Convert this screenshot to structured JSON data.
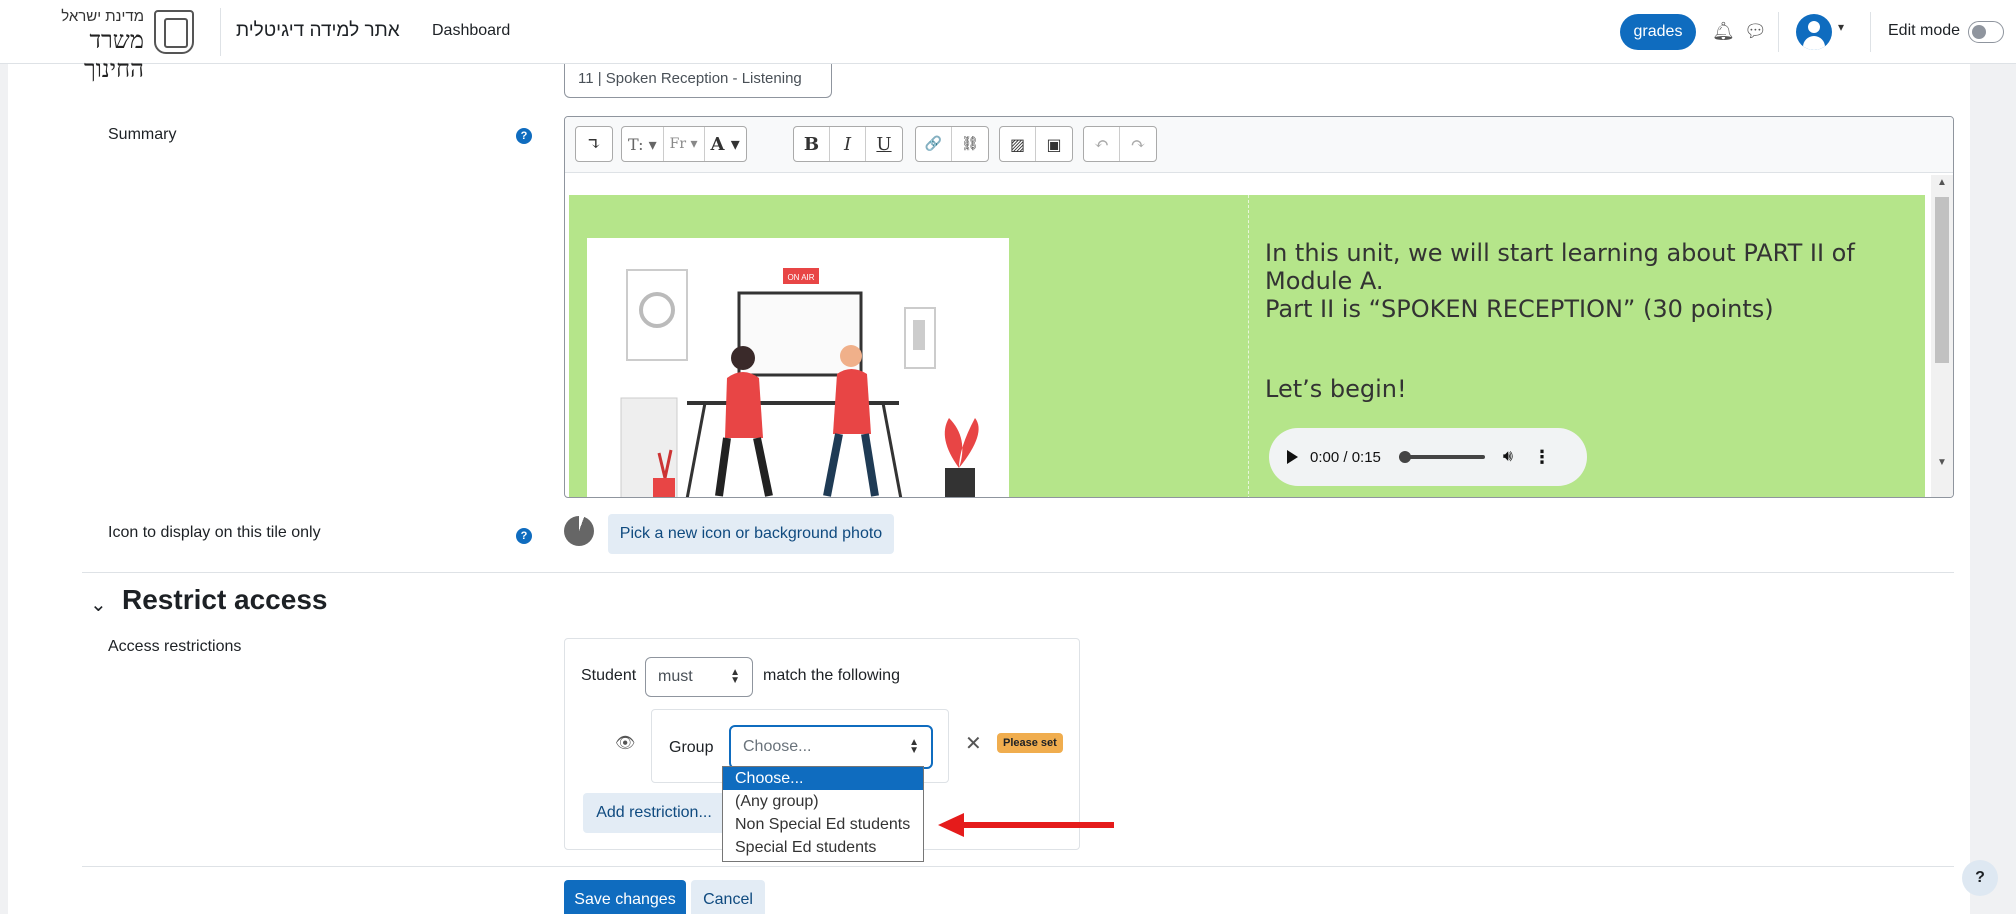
{
  "navbar": {
    "brand_line1": "מדינת ישראל",
    "brand_line2": "משרד החינוך",
    "site_name": "אתר למידה דיגיטלית",
    "dashboard": "Dashboard",
    "grades": "grades",
    "edit_mode": "Edit mode",
    "icons": [
      "bell-icon",
      "chat-icon",
      "user-avatar-icon",
      "chevron-down-icon"
    ]
  },
  "form": {
    "section_name_value": "11 | Spoken Reception - Listening",
    "summary_label": "Summary",
    "editor_toolbar": {
      "paste": "↴",
      "text_size": "T:",
      "font": "Fr",
      "color": "A",
      "bold": "B",
      "italic": "I",
      "underline": "U",
      "link": "🔗",
      "unlink": "⛓",
      "image": "▨",
      "media": "▣",
      "undo": "↶",
      "redo": "↷"
    },
    "editor_content": {
      "line1": "In this unit, we will start learning about PART II of Module A.",
      "line2": "Part II is “SPOKEN RECEPTION” (30 points)",
      "line3": "Let’s begin!",
      "illustration_badge": "ON AIR",
      "audio_time": "0:00 / 0:15"
    },
    "icon_label": "Icon to display on this tile only",
    "icon_button": "Pick a new icon or background photo"
  },
  "restrict": {
    "section_title": "Restrict access",
    "label": "Access restrictions",
    "student": "Student",
    "must_value": "must",
    "match_text": "match the following",
    "group_label": "Group",
    "group_select_value": "Choose...",
    "please_set": "Please set",
    "add_restriction": "Add restriction...",
    "group_options": [
      {
        "label": "Choose...",
        "selected": true
      },
      {
        "label": "(Any group)",
        "selected": false
      },
      {
        "label": "Non Special Ed students",
        "selected": false
      },
      {
        "label": "Special Ed students",
        "selected": false
      }
    ]
  },
  "actions": {
    "save": "Save changes",
    "cancel": "Cancel",
    "help": "?"
  },
  "colors": {
    "primary": "#0f6cbf",
    "editor_bg": "#b5e58a",
    "badge": "#f0ad4e",
    "annotation_arrow": "#e51b1b"
  }
}
